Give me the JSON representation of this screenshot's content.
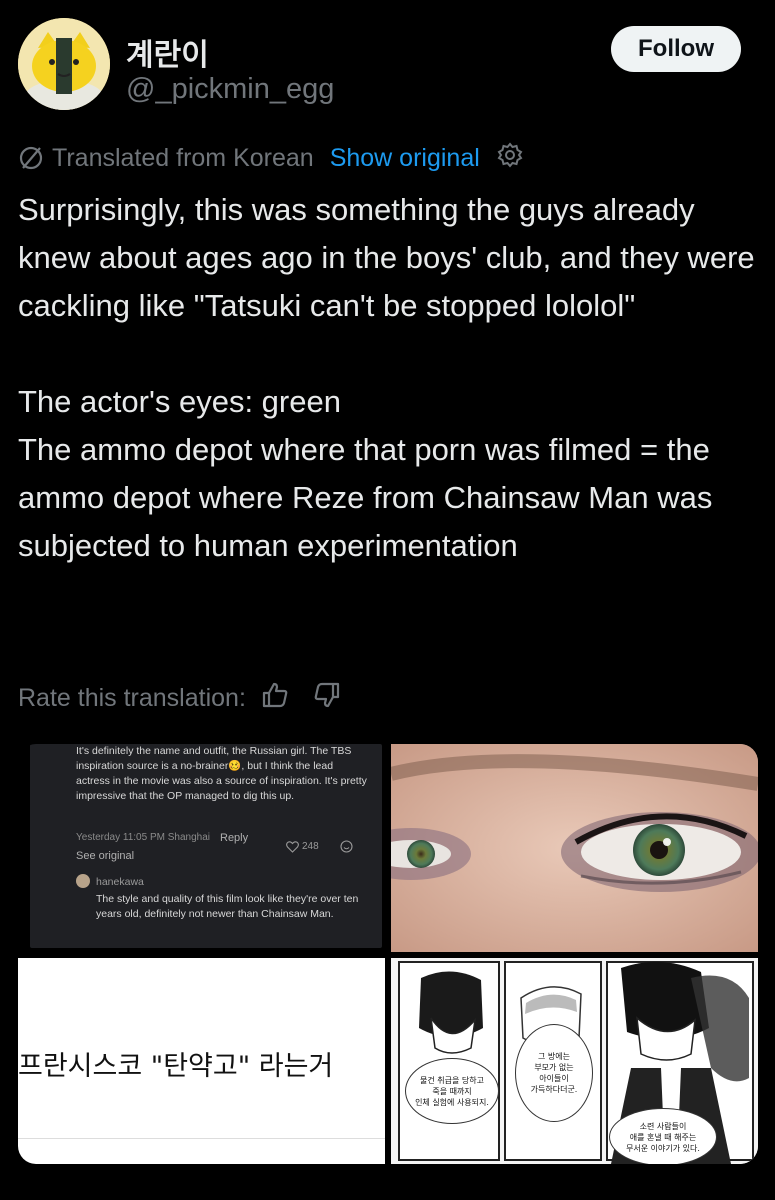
{
  "user": {
    "display_name": "계란이",
    "handle": "@_pickmin_egg",
    "follow_label": "Follow"
  },
  "translation": {
    "notice": "Translated from Korean",
    "show_original": "Show original",
    "rate_label": "Rate this translation:"
  },
  "tweet": {
    "text": "Surprisingly, this was something the guys already knew about ages ago in the boys' club, and they were cackling like \"Tatsuki can't be stopped lololol\"\n\nThe actor's eyes: green\nThe ammo depot where that porn was filmed = the ammo depot where Reze from Chainsaw Man was subjected to human experimentation"
  },
  "media": {
    "comment_card": {
      "comment1": "It's definitely the name and outfit, the Russian girl. The TBS inspiration source is a no-brainer🥴, but I think the lead actress in the movie was also a source of inspiration. It's pretty impressive that the OP managed to dig this up.",
      "timestamp": "Yesterday 11:05 PM Shanghai",
      "reply": "Reply",
      "see_original": "See original",
      "likes": "248",
      "commenter": "hanekawa",
      "comment2": "The style and quality of this film look like they're over ten years old, definitely not newer than Chainsaw Man."
    },
    "korean_caption": "프란시스코 \"탄약고\" 라는거",
    "manga_bubbles": [
      "물건 취급을 당하고\n죽을 때까지\n인체 실험에 사용되지.",
      "그 방에는\n부모가 없는\n아이들이\n가득하다더군.",
      "소련 사람들이\n애를 혼낼 때 해주는\n무서운 이야기가 있다."
    ]
  },
  "colors": {
    "background": "#000000",
    "text": "#e7e9ea",
    "muted": "#71767b",
    "link": "#1d9bf0",
    "follow_bg": "#eff3f4"
  }
}
